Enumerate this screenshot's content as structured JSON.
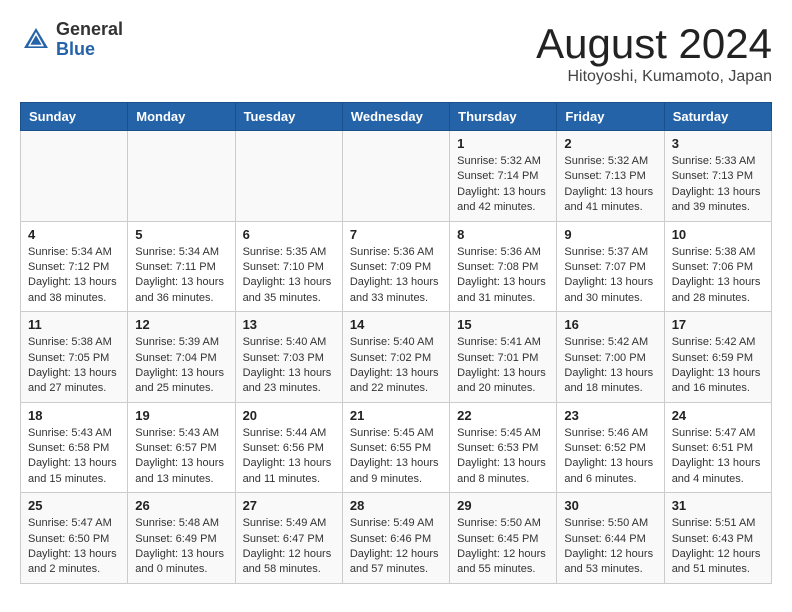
{
  "header": {
    "logo_general": "General",
    "logo_blue": "Blue",
    "month_title": "August 2024",
    "location": "Hitoyoshi, Kumamoto, Japan"
  },
  "days_of_week": [
    "Sunday",
    "Monday",
    "Tuesday",
    "Wednesday",
    "Thursday",
    "Friday",
    "Saturday"
  ],
  "weeks": [
    {
      "days": [
        {
          "num": "",
          "info": ""
        },
        {
          "num": "",
          "info": ""
        },
        {
          "num": "",
          "info": ""
        },
        {
          "num": "",
          "info": ""
        },
        {
          "num": "1",
          "info": "Sunrise: 5:32 AM\nSunset: 7:14 PM\nDaylight: 13 hours\nand 42 minutes."
        },
        {
          "num": "2",
          "info": "Sunrise: 5:32 AM\nSunset: 7:13 PM\nDaylight: 13 hours\nand 41 minutes."
        },
        {
          "num": "3",
          "info": "Sunrise: 5:33 AM\nSunset: 7:13 PM\nDaylight: 13 hours\nand 39 minutes."
        }
      ]
    },
    {
      "days": [
        {
          "num": "4",
          "info": "Sunrise: 5:34 AM\nSunset: 7:12 PM\nDaylight: 13 hours\nand 38 minutes."
        },
        {
          "num": "5",
          "info": "Sunrise: 5:34 AM\nSunset: 7:11 PM\nDaylight: 13 hours\nand 36 minutes."
        },
        {
          "num": "6",
          "info": "Sunrise: 5:35 AM\nSunset: 7:10 PM\nDaylight: 13 hours\nand 35 minutes."
        },
        {
          "num": "7",
          "info": "Sunrise: 5:36 AM\nSunset: 7:09 PM\nDaylight: 13 hours\nand 33 minutes."
        },
        {
          "num": "8",
          "info": "Sunrise: 5:36 AM\nSunset: 7:08 PM\nDaylight: 13 hours\nand 31 minutes."
        },
        {
          "num": "9",
          "info": "Sunrise: 5:37 AM\nSunset: 7:07 PM\nDaylight: 13 hours\nand 30 minutes."
        },
        {
          "num": "10",
          "info": "Sunrise: 5:38 AM\nSunset: 7:06 PM\nDaylight: 13 hours\nand 28 minutes."
        }
      ]
    },
    {
      "days": [
        {
          "num": "11",
          "info": "Sunrise: 5:38 AM\nSunset: 7:05 PM\nDaylight: 13 hours\nand 27 minutes."
        },
        {
          "num": "12",
          "info": "Sunrise: 5:39 AM\nSunset: 7:04 PM\nDaylight: 13 hours\nand 25 minutes."
        },
        {
          "num": "13",
          "info": "Sunrise: 5:40 AM\nSunset: 7:03 PM\nDaylight: 13 hours\nand 23 minutes."
        },
        {
          "num": "14",
          "info": "Sunrise: 5:40 AM\nSunset: 7:02 PM\nDaylight: 13 hours\nand 22 minutes."
        },
        {
          "num": "15",
          "info": "Sunrise: 5:41 AM\nSunset: 7:01 PM\nDaylight: 13 hours\nand 20 minutes."
        },
        {
          "num": "16",
          "info": "Sunrise: 5:42 AM\nSunset: 7:00 PM\nDaylight: 13 hours\nand 18 minutes."
        },
        {
          "num": "17",
          "info": "Sunrise: 5:42 AM\nSunset: 6:59 PM\nDaylight: 13 hours\nand 16 minutes."
        }
      ]
    },
    {
      "days": [
        {
          "num": "18",
          "info": "Sunrise: 5:43 AM\nSunset: 6:58 PM\nDaylight: 13 hours\nand 15 minutes."
        },
        {
          "num": "19",
          "info": "Sunrise: 5:43 AM\nSunset: 6:57 PM\nDaylight: 13 hours\nand 13 minutes."
        },
        {
          "num": "20",
          "info": "Sunrise: 5:44 AM\nSunset: 6:56 PM\nDaylight: 13 hours\nand 11 minutes."
        },
        {
          "num": "21",
          "info": "Sunrise: 5:45 AM\nSunset: 6:55 PM\nDaylight: 13 hours\nand 9 minutes."
        },
        {
          "num": "22",
          "info": "Sunrise: 5:45 AM\nSunset: 6:53 PM\nDaylight: 13 hours\nand 8 minutes."
        },
        {
          "num": "23",
          "info": "Sunrise: 5:46 AM\nSunset: 6:52 PM\nDaylight: 13 hours\nand 6 minutes."
        },
        {
          "num": "24",
          "info": "Sunrise: 5:47 AM\nSunset: 6:51 PM\nDaylight: 13 hours\nand 4 minutes."
        }
      ]
    },
    {
      "days": [
        {
          "num": "25",
          "info": "Sunrise: 5:47 AM\nSunset: 6:50 PM\nDaylight: 13 hours\nand 2 minutes."
        },
        {
          "num": "26",
          "info": "Sunrise: 5:48 AM\nSunset: 6:49 PM\nDaylight: 13 hours\nand 0 minutes."
        },
        {
          "num": "27",
          "info": "Sunrise: 5:49 AM\nSunset: 6:47 PM\nDaylight: 12 hours\nand 58 minutes."
        },
        {
          "num": "28",
          "info": "Sunrise: 5:49 AM\nSunset: 6:46 PM\nDaylight: 12 hours\nand 57 minutes."
        },
        {
          "num": "29",
          "info": "Sunrise: 5:50 AM\nSunset: 6:45 PM\nDaylight: 12 hours\nand 55 minutes."
        },
        {
          "num": "30",
          "info": "Sunrise: 5:50 AM\nSunset: 6:44 PM\nDaylight: 12 hours\nand 53 minutes."
        },
        {
          "num": "31",
          "info": "Sunrise: 5:51 AM\nSunset: 6:43 PM\nDaylight: 12 hours\nand 51 minutes."
        }
      ]
    }
  ]
}
